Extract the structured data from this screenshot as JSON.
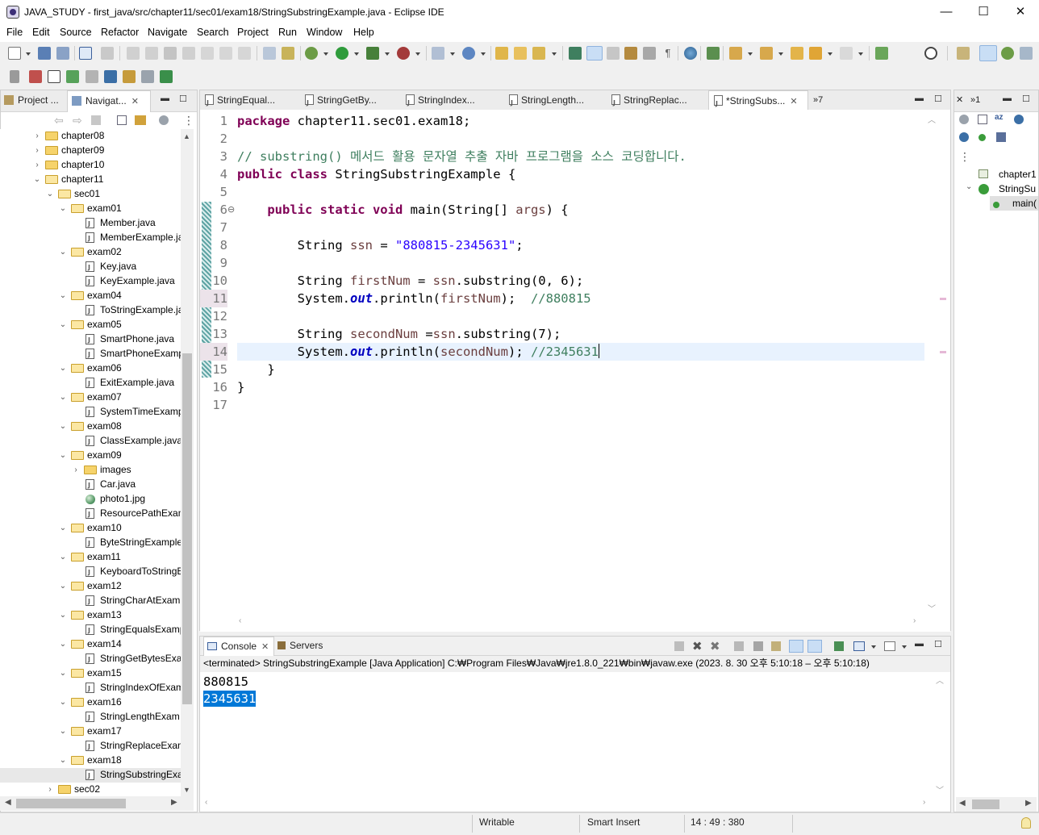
{
  "window": {
    "title": "JAVA_STUDY - first_java/src/chapter11/sec01/exam18/StringSubstringExample.java - Eclipse IDE",
    "minimize_glyph": "—",
    "maximize_glyph": "☐",
    "close_glyph": "✕"
  },
  "menu": [
    "File",
    "Edit",
    "Source",
    "Refactor",
    "Navigate",
    "Search",
    "Project",
    "Run",
    "Window",
    "Help"
  ],
  "left_panel": {
    "tabs": [
      "Project ...",
      "Navigat..."
    ],
    "tree": [
      {
        "label": "chapter08",
        "level": 1,
        "type": "folder",
        "twist": "›"
      },
      {
        "label": "chapter09",
        "level": 1,
        "type": "folder",
        "twist": "›"
      },
      {
        "label": "chapter10",
        "level": 1,
        "type": "folder",
        "twist": "›"
      },
      {
        "label": "chapter11",
        "level": 1,
        "type": "folder-open",
        "twist": "⌄"
      },
      {
        "label": "sec01",
        "level": 2,
        "type": "folder-open",
        "twist": "⌄"
      },
      {
        "label": "exam01",
        "level": 3,
        "type": "folder-open",
        "twist": "⌄"
      },
      {
        "label": "Member.java",
        "level": 4,
        "type": "java"
      },
      {
        "label": "MemberExample.ja",
        "level": 4,
        "type": "java"
      },
      {
        "label": "exam02",
        "level": 3,
        "type": "folder-open",
        "twist": "⌄"
      },
      {
        "label": "Key.java",
        "level": 4,
        "type": "java"
      },
      {
        "label": "KeyExample.java",
        "level": 4,
        "type": "java"
      },
      {
        "label": "exam04",
        "level": 3,
        "type": "folder-open",
        "twist": "⌄"
      },
      {
        "label": "ToStringExample.ja",
        "level": 4,
        "type": "java"
      },
      {
        "label": "exam05",
        "level": 3,
        "type": "folder-open",
        "twist": "⌄"
      },
      {
        "label": "SmartPhone.java",
        "level": 4,
        "type": "java"
      },
      {
        "label": "SmartPhoneExamp",
        "level": 4,
        "type": "java"
      },
      {
        "label": "exam06",
        "level": 3,
        "type": "folder-open",
        "twist": "⌄"
      },
      {
        "label": "ExitExample.java",
        "level": 4,
        "type": "java"
      },
      {
        "label": "exam07",
        "level": 3,
        "type": "folder-open",
        "twist": "⌄"
      },
      {
        "label": "SystemTimeExamp",
        "level": 4,
        "type": "java"
      },
      {
        "label": "exam08",
        "level": 3,
        "type": "folder-open",
        "twist": "⌄"
      },
      {
        "label": "ClassExample.java",
        "level": 4,
        "type": "java"
      },
      {
        "label": "exam09",
        "level": 3,
        "type": "folder-open",
        "twist": "⌄"
      },
      {
        "label": "images",
        "level": 4,
        "type": "folder",
        "twist": "›"
      },
      {
        "label": "Car.java",
        "level": 4,
        "type": "java"
      },
      {
        "label": "photo1.jpg",
        "level": 4,
        "type": "image"
      },
      {
        "label": "ResourcePathExam",
        "level": 4,
        "type": "java"
      },
      {
        "label": "exam10",
        "level": 3,
        "type": "folder-open",
        "twist": "⌄"
      },
      {
        "label": "ByteStringExample",
        "level": 4,
        "type": "java"
      },
      {
        "label": "exam11",
        "level": 3,
        "type": "folder-open",
        "twist": "⌄"
      },
      {
        "label": "KeyboardToStringE",
        "level": 4,
        "type": "java"
      },
      {
        "label": "exam12",
        "level": 3,
        "type": "folder-open",
        "twist": "⌄"
      },
      {
        "label": "StringCharAtExam",
        "level": 4,
        "type": "java"
      },
      {
        "label": "exam13",
        "level": 3,
        "type": "folder-open",
        "twist": "⌄"
      },
      {
        "label": "StringEqualsExamp",
        "level": 4,
        "type": "java"
      },
      {
        "label": "exam14",
        "level": 3,
        "type": "folder-open",
        "twist": "⌄"
      },
      {
        "label": "StringGetBytesExar",
        "level": 4,
        "type": "java"
      },
      {
        "label": "exam15",
        "level": 3,
        "type": "folder-open",
        "twist": "⌄"
      },
      {
        "label": "StringIndexOfExam",
        "level": 4,
        "type": "java"
      },
      {
        "label": "exam16",
        "level": 3,
        "type": "folder-open",
        "twist": "⌄"
      },
      {
        "label": "StringLengthExam",
        "level": 4,
        "type": "java"
      },
      {
        "label": "exam17",
        "level": 3,
        "type": "folder-open",
        "twist": "⌄"
      },
      {
        "label": "StringReplaceExam",
        "level": 4,
        "type": "java"
      },
      {
        "label": "exam18",
        "level": 3,
        "type": "folder-open",
        "twist": "⌄"
      },
      {
        "label": "StringSubstringExa",
        "level": 4,
        "type": "java",
        "selected": true
      },
      {
        "label": "sec02",
        "level": 2,
        "type": "folder",
        "twist": "›"
      }
    ]
  },
  "editor": {
    "tabs": [
      "StringEqual...",
      "StringGetBy...",
      "StringIndex...",
      "StringLength...",
      "StringReplac...",
      "*StringSubs..."
    ],
    "overflow_label": "»7",
    "line_numbers": [
      "1",
      "2",
      "3",
      "4",
      "5",
      "6",
      "7",
      "8",
      "9",
      "10",
      "11",
      "12",
      "13",
      "14",
      "15",
      "16",
      "17"
    ],
    "lines": {
      "l1_kw": "package",
      "l1_rest": " chapter11.sec01.exam18;",
      "l3_comment": "// substring() 메서드 활용 문자열 추출 자바 프로그램을 소스 코딩합니다.",
      "l4_kw": "public class",
      "l4_rest": " StringSubstringExample {",
      "l6_indent": "    ",
      "l6_kw": "public static void",
      "l6_rest1": " main(String[] ",
      "l6_var": "args",
      "l6_rest2": ") {",
      "l8_indent": "        ",
      "l8_type": "String ",
      "l8_var": "ssn",
      "l8_eq": " = ",
      "l8_str": "\"880815-2345631\"",
      "l8_end": ";",
      "l10_indent": "        ",
      "l10_type": "String ",
      "l10_var": "firstNum",
      "l10_eq": " = ",
      "l10_obj": "ssn",
      "l10_call": ".substring(0, 6);",
      "l11_indent": "        ",
      "l11_sys": "System.",
      "l11_out": "out",
      "l11_print": ".println(",
      "l11_var": "firstNum",
      "l11_end": ");  ",
      "l11_cmt": "//880815",
      "l13_indent": "        ",
      "l13_type": "String ",
      "l13_var": "secondNum",
      "l13_eq": " =",
      "l13_obj": "ssn",
      "l13_call": ".substring(7);",
      "l14_indent": "        ",
      "l14_sys": "System.",
      "l14_out": "out",
      "l14_print": ".println(",
      "l14_var": "secondNum",
      "l14_end": "); ",
      "l14_cmt": "//2345631",
      "l15": "    }",
      "l16": "}"
    },
    "fold_marker": "⊖"
  },
  "right_panel": {
    "outline_items": [
      "chapter1",
      "StringSu",
      "main("
    ],
    "tab_label": "»1"
  },
  "console": {
    "tabs": [
      "Console",
      "Servers"
    ],
    "terminated_line": "<terminated> StringSubstringExample [Java Application] C:₩Program Files₩Java₩jre1.8.0_221₩bin₩javaw.exe  (2023. 8. 30 오후 5:10:18 – 오후 5:10:18)",
    "output": [
      "880815",
      "2345631"
    ]
  },
  "status": {
    "mode": "Writable",
    "insert": "Smart Insert",
    "position": "14 : 49 : 380"
  },
  "colors": {
    "keyword": "#7f0055",
    "string": "#2a00ff",
    "comment": "#3f7f5f",
    "field": "#0000c0",
    "selection": "#0078d7",
    "current_line": "#e8f2fe"
  }
}
